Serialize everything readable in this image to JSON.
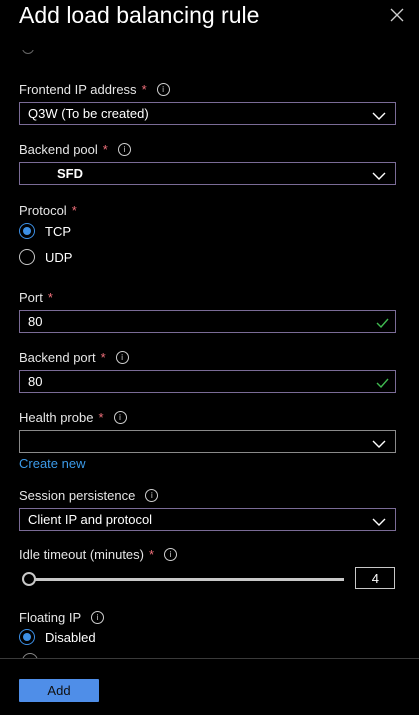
{
  "header": {
    "title": "Add load balancing rule"
  },
  "frontend_ip": {
    "label": "Frontend IP address",
    "required": "*",
    "value": "Q3W (To be created)"
  },
  "backend_pool": {
    "label": "Backend pool",
    "required": "*",
    "value": "SFD"
  },
  "protocol": {
    "label": "Protocol",
    "required": "*",
    "options": [
      "TCP",
      "UDP"
    ],
    "selected": "TCP"
  },
  "port": {
    "label": "Port",
    "required": "*",
    "value": "80"
  },
  "backend_port": {
    "label": "Backend port",
    "required": "*",
    "value": "80"
  },
  "health_probe": {
    "label": "Health probe",
    "required": "*",
    "value": "",
    "create_new": "Create new"
  },
  "session_persistence": {
    "label": "Session persistence",
    "value": "Client IP and protocol"
  },
  "idle_timeout": {
    "label": "Idle timeout (minutes)",
    "required": "*",
    "value": "4"
  },
  "floating_ip": {
    "label": "Floating IP",
    "options": [
      "Disabled"
    ],
    "selected": "Disabled"
  },
  "footer": {
    "add_label": "Add"
  },
  "colors": {
    "accent": "#3c8fe5",
    "field_border": "#7a6b96",
    "required": "#f1707b",
    "check": "#3fb950",
    "button": "#4f8ee8"
  }
}
